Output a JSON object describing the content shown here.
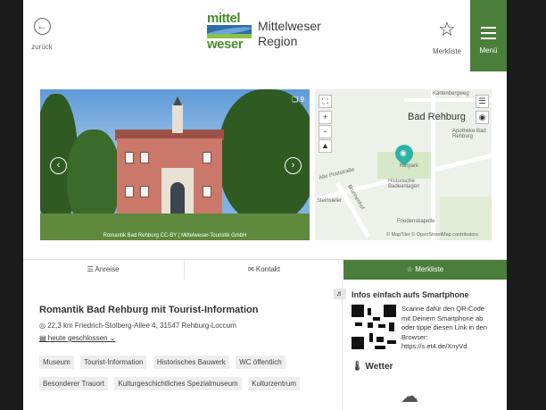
{
  "header": {
    "back_label": "zurück",
    "logo_top": "mittel",
    "logo_bottom": "weser",
    "brand_line1": "Mittelweser",
    "brand_line2": "Region",
    "merkliste_label": "Merkliste",
    "menu_label": "Menü"
  },
  "photo": {
    "caption": "Romantik Bad Rehburg CC-BY | Mittelweser-Touristik GmbH",
    "gallery_count": "9"
  },
  "map": {
    "labels": [
      "Bad Rehburg",
      "Alte Poststraße",
      "Kurpark",
      "Historische Badeanlagen",
      "Brunnenhof",
      "Apotheke Bad Rehburg",
      "Friedenskapelle",
      "Steinsieler",
      "Kärtenbergweg"
    ],
    "attribution": "© MapTiler © OpenStreetMap contributors"
  },
  "tabs": [
    "Anreise",
    "Kontakt",
    "Merkliste"
  ],
  "detail": {
    "title": "Romantik Bad Rehburg mit Tourist-Information",
    "address": "22,3 km Friedrich-Stolberg-Allee 4, 31547 Rehburg-Loccum",
    "hours": "heute geschlossen",
    "tags": [
      "Museum",
      "Tourist-Information",
      "Historisches Bauwerk",
      "WC öffentlich",
      "Besonderer Trauort",
      "Kulturgeschichtliches Spezialmuseum",
      "Kulturzentrum"
    ]
  },
  "sidebar": {
    "title": "Infos einfach aufs Smartphone",
    "qr_text": "Scanne dafür den QR-Code mit Deinem Smartphone ab oder tippe diesen Link in den Browser: https://s.et4.de/XnyVd",
    "weather_title": "Wetter"
  },
  "colors": {
    "accent": "#4b7e3a",
    "pin": "#2bb3a3"
  }
}
